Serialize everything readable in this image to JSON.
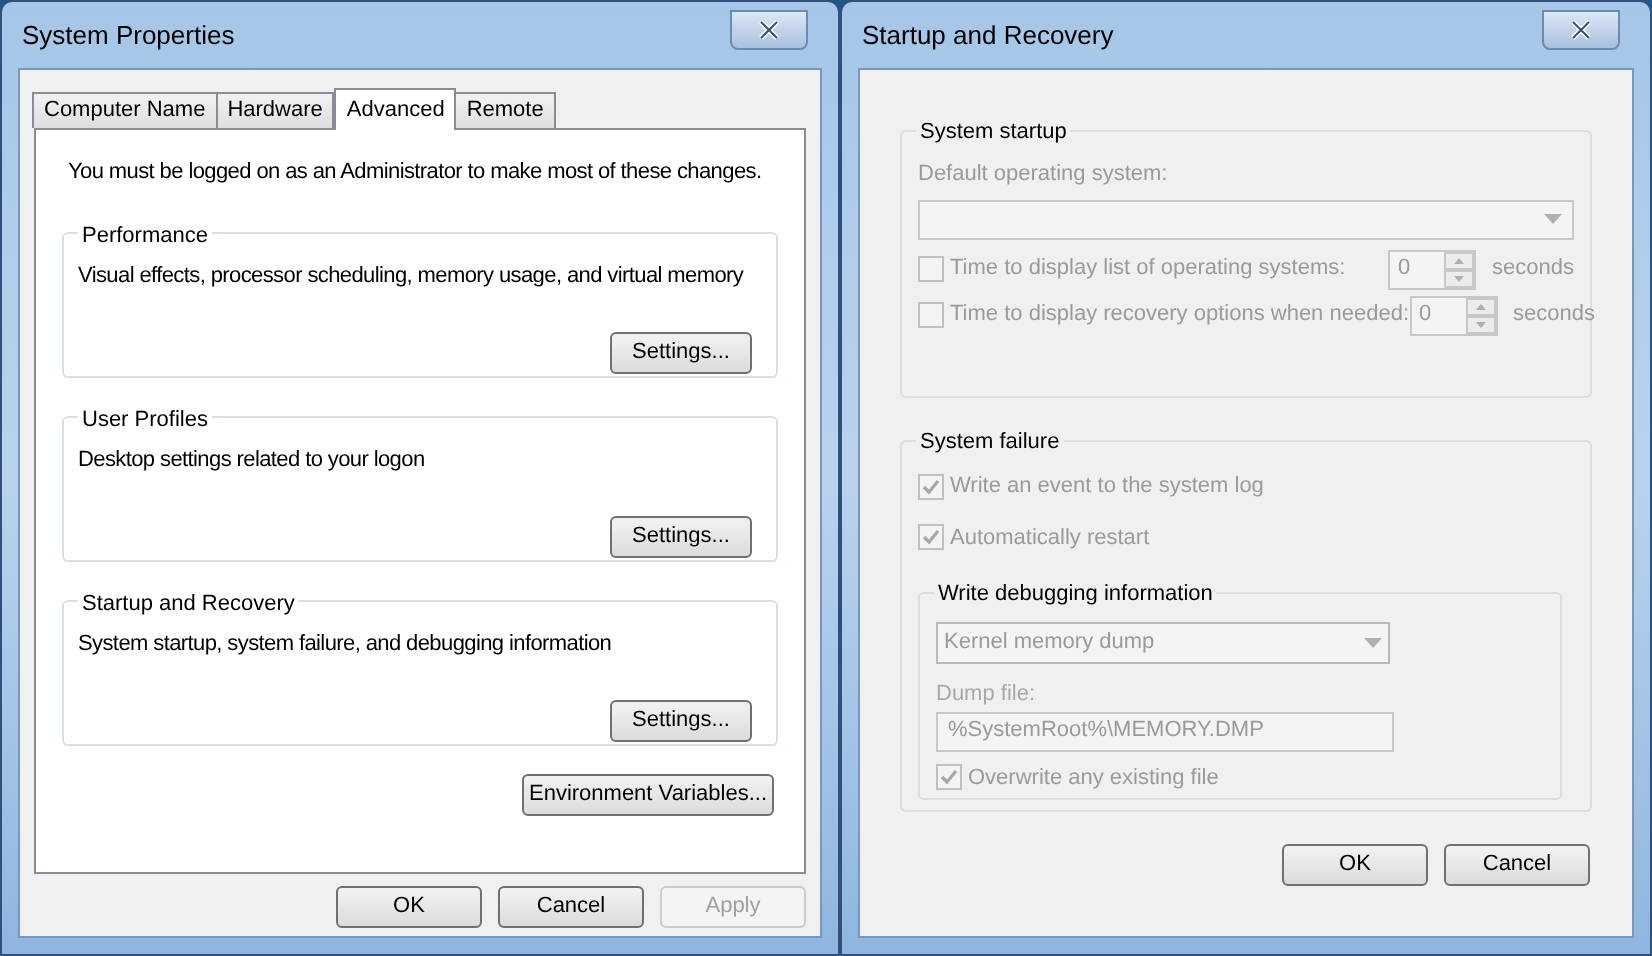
{
  "system_properties": {
    "title": "System Properties",
    "tabs": [
      {
        "label": "Computer Name",
        "selected": false
      },
      {
        "label": "Hardware",
        "selected": false
      },
      {
        "label": "Advanced",
        "selected": true
      },
      {
        "label": "Remote",
        "selected": false
      }
    ],
    "notice": "You must be logged on as an Administrator to make most of these changes.",
    "groups": [
      {
        "title": "Performance",
        "description": "Visual effects, processor scheduling, memory usage, and virtual memory",
        "button": "Settings..."
      },
      {
        "title": "User Profiles",
        "description": "Desktop settings related to your logon",
        "button": "Settings..."
      },
      {
        "title": "Startup and Recovery",
        "description": "System startup, system failure, and debugging information",
        "button": "Settings..."
      }
    ],
    "environment_button": "Environment Variables...",
    "buttons": [
      {
        "label": "OK",
        "disabled": false
      },
      {
        "label": "Cancel",
        "disabled": false
      },
      {
        "label": "Apply",
        "disabled": true
      }
    ]
  },
  "startup_recovery": {
    "title": "Startup and Recovery",
    "system_startup": {
      "title": "System startup",
      "disabled": true,
      "default_os_label": "Default operating system:",
      "timers": [
        {
          "label": "Time to display list of operating systems:",
          "checked": false,
          "value": "0",
          "unit": "seconds"
        },
        {
          "label": "Time to display recovery options when needed:",
          "checked": false,
          "value": "0",
          "unit": "seconds"
        }
      ]
    },
    "system_failure": {
      "title": "System failure",
      "disabled": true,
      "options": [
        {
          "label": "Write an event to the system log",
          "checked": true
        },
        {
          "label": "Automatically restart",
          "checked": true
        }
      ],
      "debugging": {
        "title": "Write debugging information",
        "dump_type": "Kernel memory dump",
        "dump_file_label": "Dump file:",
        "dump_file": "%SystemRoot%\\MEMORY.DMP",
        "overwrite": {
          "label": "Overwrite any existing file",
          "checked": true
        }
      }
    },
    "buttons": [
      {
        "label": "OK",
        "disabled": false
      },
      {
        "label": "Cancel",
        "disabled": false
      }
    ]
  }
}
